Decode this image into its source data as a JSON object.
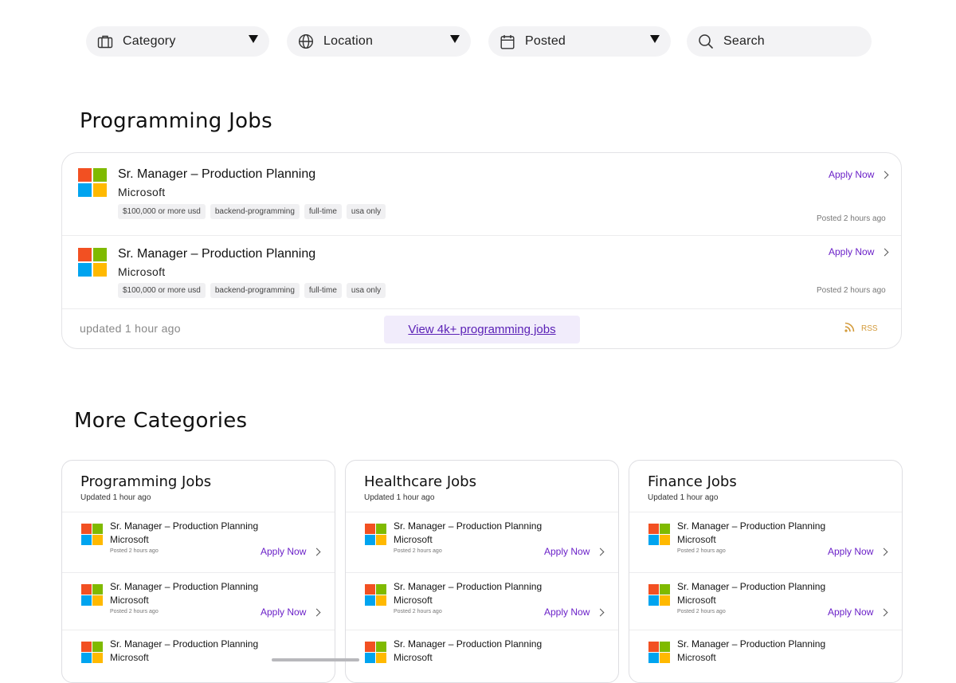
{
  "filters": {
    "category": {
      "label": "Category",
      "icon": "briefcase-icon"
    },
    "location": {
      "label": "Location",
      "icon": "globe-icon"
    },
    "posted": {
      "label": "Posted",
      "icon": "calendar-icon"
    },
    "search": {
      "placeholder": "Search",
      "icon": "search-icon"
    }
  },
  "featured": {
    "heading": "Programming Jobs",
    "jobs": [
      {
        "title": "Sr. Manager – Production Planning",
        "company": "Microsoft",
        "tags": [
          "$100,000 or more usd",
          "backend-programming",
          "full-time",
          "usa only"
        ],
        "apply": "Apply Now",
        "posted": "Posted 2 hours ago"
      },
      {
        "title": "Sr. Manager – Production Planning",
        "company": "Microsoft",
        "tags": [
          "$100,000 or more usd",
          "backend-programming",
          "full-time",
          "usa only"
        ],
        "apply": "Apply Now",
        "posted": "Posted 2 hours ago"
      }
    ],
    "footer": {
      "updated": "updated 1 hour ago",
      "view_all": "View 4k+ programming jobs",
      "rss": "RSS"
    }
  },
  "more": {
    "heading": "More Categories",
    "categories": [
      {
        "title": "Programming Jobs",
        "updated": "Updated 1 hour ago",
        "jobs": [
          {
            "title": "Sr. Manager – Production Planning",
            "company": "Microsoft",
            "posted": "Posted 2 hours ago",
            "apply": "Apply Now"
          },
          {
            "title": "Sr. Manager – Production Planning",
            "company": "Microsoft",
            "posted": "Posted 2 hours ago",
            "apply": "Apply Now"
          },
          {
            "title": "Sr. Manager – Production Planning",
            "company": "Microsoft",
            "posted": "",
            "apply": ""
          }
        ]
      },
      {
        "title": "Healthcare Jobs",
        "updated": "Updated 1 hour ago",
        "jobs": [
          {
            "title": "Sr. Manager – Production Planning",
            "company": "Microsoft",
            "posted": "Posted 2 hours ago",
            "apply": "Apply Now"
          },
          {
            "title": "Sr. Manager – Production Planning",
            "company": "Microsoft",
            "posted": "Posted 2 hours ago",
            "apply": "Apply Now"
          },
          {
            "title": "Sr. Manager – Production Planning",
            "company": "Microsoft",
            "posted": "",
            "apply": ""
          }
        ]
      },
      {
        "title": "Finance Jobs",
        "updated": "Updated 1 hour ago",
        "jobs": [
          {
            "title": "Sr. Manager – Production Planning",
            "company": "Microsoft",
            "posted": "Posted 2 hours ago",
            "apply": "Apply Now"
          },
          {
            "title": "Sr. Manager – Production Planning",
            "company": "Microsoft",
            "posted": "Posted 2 hours ago",
            "apply": "Apply Now"
          },
          {
            "title": "Sr. Manager – Production Planning",
            "company": "Microsoft",
            "posted": "",
            "apply": ""
          }
        ]
      }
    ]
  },
  "colors": {
    "accent": "#6b21c8",
    "rss": "#d39a3a",
    "pill_bg": "#f3f3f5"
  }
}
